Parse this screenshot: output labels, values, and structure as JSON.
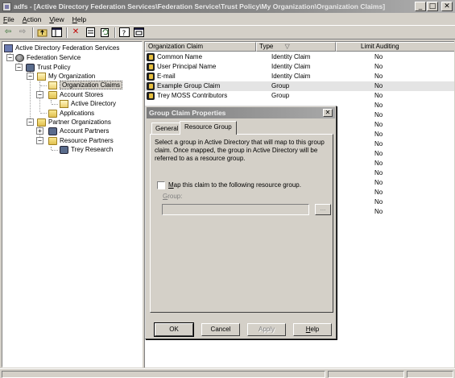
{
  "window": {
    "title": "adfs - [Active Directory Federation Services\\Federation Service\\Trust Policy\\My Organization\\Organization Claims]",
    "controls": {
      "minimize": "_",
      "maximize": "□",
      "close": "✕"
    }
  },
  "menu": [
    {
      "key": "F",
      "rest": "ile"
    },
    {
      "key": "A",
      "rest": "ction"
    },
    {
      "key": "V",
      "rest": "iew"
    },
    {
      "key": "H",
      "rest": "elp"
    }
  ],
  "toolbar": {
    "icons": [
      "back-arrow-icon",
      "forward-arrow-icon",
      "up-folder-icon",
      "show-tree-icon",
      "delete-icon",
      "properties-icon",
      "refresh-icon",
      "help-icon",
      "console-icon"
    ]
  },
  "tree": {
    "root": "Active Directory Federation Services",
    "federation_service": "Federation Service",
    "trust_policy": "Trust Policy",
    "my_organization": "My Organization",
    "organization_claims": "Organization Claims",
    "account_stores": "Account Stores",
    "active_directory": "Active Directory",
    "applications": "Applications",
    "partner_organizations": "Partner Organizations",
    "account_partners": "Account Partners",
    "resource_partners": "Resource Partners",
    "trey_research": "Trey Research"
  },
  "list": {
    "columns": [
      "Organization Claim",
      "Type",
      "Limit Auditing"
    ],
    "sort_indicator": "▽",
    "rows": [
      {
        "claim": "Common Name",
        "type": "Identity Claim",
        "limit": "No"
      },
      {
        "claim": "User Principal Name",
        "type": "Identity Claim",
        "limit": "No"
      },
      {
        "claim": "E-mail",
        "type": "Identity Claim",
        "limit": "No"
      },
      {
        "claim": "Example Group Claim",
        "type": "Group",
        "limit": "No"
      },
      {
        "claim": "Trey MOSS Contributors",
        "type": "Group",
        "limit": "No"
      },
      {
        "claim": "",
        "type": "",
        "limit": "No"
      },
      {
        "claim": "",
        "type": "",
        "limit": "No"
      },
      {
        "claim": "",
        "type": "",
        "limit": "No"
      },
      {
        "claim": "",
        "type": "",
        "limit": "No"
      },
      {
        "claim": "",
        "type": "",
        "limit": "No"
      },
      {
        "claim": "",
        "type": "",
        "limit": "No"
      },
      {
        "claim": "",
        "type": "",
        "limit": "No"
      },
      {
        "claim": "",
        "type": "",
        "limit": "No"
      },
      {
        "claim": "",
        "type": "",
        "limit": "No"
      },
      {
        "claim": "",
        "type": "",
        "limit": "No"
      },
      {
        "claim": "",
        "type": "",
        "limit": "No"
      },
      {
        "claim": "",
        "type": "",
        "limit": "No"
      }
    ]
  },
  "dialog": {
    "title": "Group Claim Properties",
    "close": "✕",
    "tabs": [
      "General",
      "Resource Group"
    ],
    "active_tab": "Resource Group",
    "description": "Select a group in Active Directory that will map to this group claim. Once mapped, the group in Active Directory will be referred to as a resource group.",
    "checkbox_label_key": "M",
    "checkbox_label_rest": "ap this claim to the following resource group.",
    "checkbox_checked": false,
    "group_label_key": "G",
    "group_label_rest": "roup:",
    "group_value": "",
    "browse_label": "...",
    "buttons": {
      "ok": "OK",
      "cancel": "Cancel",
      "apply": "Apply",
      "help_key": "H",
      "help_rest": "elp"
    }
  }
}
